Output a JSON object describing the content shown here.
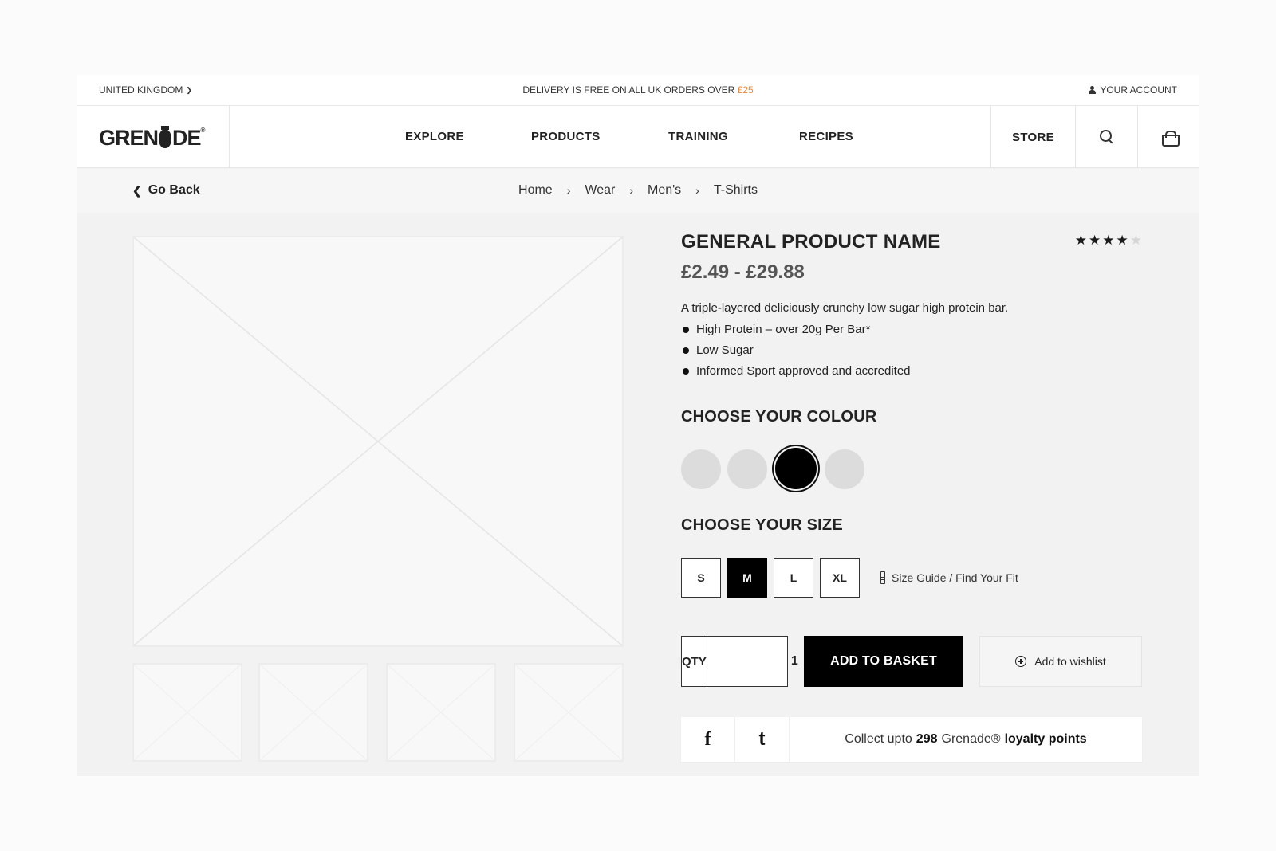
{
  "topbar": {
    "country": "UNITED KINGDOM",
    "promo_text": "DELIVERY IS FREE ON ALL UK ORDERS OVER",
    "promo_amount": "£25",
    "account": "YOUR ACCOUNT"
  },
  "nav": {
    "logo": "GREN",
    "logo_suffix": "DE",
    "links": [
      "EXPLORE",
      "PRODUCTS",
      "TRAINING",
      "RECIPES"
    ],
    "store": "STORE"
  },
  "crumbs": {
    "go_back": "Go Back",
    "items": [
      "Home",
      "Wear",
      "Men's",
      "T-Shirts"
    ],
    "separator": "›"
  },
  "product": {
    "title": "GENERAL PRODUCT NAME",
    "price": "£2.49 - £29.88",
    "rating": 4,
    "rating_max": 5,
    "description": "A triple-layered deliciously crunchy low sugar high protein bar.",
    "features": [
      "High Protein – over 20g Per Bar*",
      "Low Sugar",
      "Informed Sport approved and accredited"
    ]
  },
  "colour": {
    "title": "CHOOSE YOUR COLOUR",
    "swatches": [
      "#dcdcdc",
      "#dcdcdc",
      "#000000",
      "#dcdcdc"
    ],
    "selected_index": 2
  },
  "size": {
    "title": "CHOOSE YOUR SIZE",
    "options": [
      "S",
      "M",
      "L",
      "XL"
    ],
    "selected": "M",
    "guide_label": "Size Guide / Find Your Fit"
  },
  "purchase": {
    "qty_label": "QTY",
    "qty_value": "1",
    "add_to_basket": "ADD TO BASKET",
    "wishlist": "Add to wishlist"
  },
  "share": {
    "facebook_glyph": "f",
    "twitter_glyph": "t",
    "loyalty_prefix": "Collect upto",
    "loyalty_points": "298",
    "loyalty_brand": "Grenade®",
    "loyalty_suffix": "loyalty points"
  }
}
